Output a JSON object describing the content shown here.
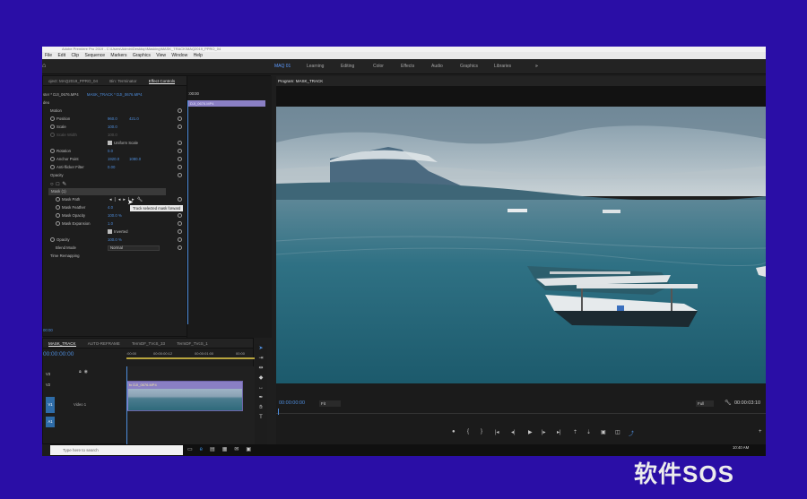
{
  "window": {
    "title": "Adobe Premiere Pro 2019 - C:\\Users\\Admin\\Desktop\\Masking\\MASK_TRACK\\MAQ2019_PPRO_04"
  },
  "menu": [
    "File",
    "Edit",
    "Clip",
    "Sequence",
    "Markers",
    "Graphics",
    "View",
    "Window",
    "Help"
  ],
  "workspaces": {
    "items": [
      "MAQ 01",
      "Learning",
      "Editing",
      "Color",
      "Effects",
      "Audio",
      "Graphics",
      "Libraries"
    ],
    "more": "»",
    "active": "MAQ 01"
  },
  "left_tabs": [
    "oject: MAQ2019_PPRO_04",
    "Bin: Terminator",
    "Effect Controls"
  ],
  "effect_controls": {
    "header": "ster * DJI_0676.MP4",
    "sequence": "MASK_TRACK * DJI_0676.MP4",
    "timecode": ":00:00",
    "clip_bar": "DJI_0676.MP4",
    "video_label": "deo",
    "motion": "Motion",
    "rows": [
      {
        "label": "Position",
        "v1": "960.0",
        "v2": "421.0"
      },
      {
        "label": "Scale",
        "v1": "100.0",
        "v2": ""
      },
      {
        "label": "Scale Width",
        "v1": "100.0",
        "v2": ""
      },
      {
        "label": "Uniform Scale",
        "v1": "",
        "v2": ""
      },
      {
        "label": "Rotation",
        "v1": "0.0",
        "v2": ""
      },
      {
        "label": "Anchor Point",
        "v1": "1920.0",
        "v2": "1080.0"
      },
      {
        "label": "Anti-flicker Filter",
        "v1": "0.00",
        "v2": ""
      }
    ],
    "opacity_section": "Opacity",
    "mask_name": "Mask (1)",
    "mask_rows": [
      {
        "label": "Mask Path",
        "v1": "",
        "v2": ""
      },
      {
        "label": "Mask Feather",
        "v1": "4.0",
        "v2": ""
      },
      {
        "label": "Mask Opacity",
        "v1": "100.0 %",
        "v2": ""
      },
      {
        "label": "Mask Expansion",
        "v1": "1.0",
        "v2": ""
      },
      {
        "label": "Inverted",
        "v1": "",
        "v2": ""
      },
      {
        "label": "Opacity",
        "v1": "100.0 %",
        "v2": ""
      },
      {
        "label": "Blend Mode",
        "v1": "Normal",
        "v2": ""
      }
    ],
    "time_remap": "Time Remapping",
    "tooltip": "Track selected mask forward",
    "bottom_tc": "00:00"
  },
  "timeline": {
    "tabs": [
      "MASK_TRACK",
      "AUTO-REFRAME",
      "TermDF_TVcS_33",
      "TermDF_TVcS_1"
    ],
    "timecode": "00:00:00:00",
    "ruler": [
      ":00:00",
      "00:00:00:12",
      "00:00:01:00",
      "00:00"
    ],
    "tracks": [
      "V3",
      "V2",
      "V1",
      "A1"
    ],
    "video1_label": "Video 1",
    "clip_label": "fx DJI_0676.MP4"
  },
  "program": {
    "title": "Program: MASK_TRACK",
    "timecode": "00:00:00:00",
    "fit": "Fit",
    "quality": "Full",
    "duration": "00:00:03:10"
  },
  "taskbar": {
    "search_placeholder": "Type here to search",
    "time": "10:40 AM"
  },
  "watermark": "软件SOS",
  "colors": {
    "accent": "#4e8ddc",
    "background": "#2a0ea6",
    "clip": "#8a7fc4"
  }
}
